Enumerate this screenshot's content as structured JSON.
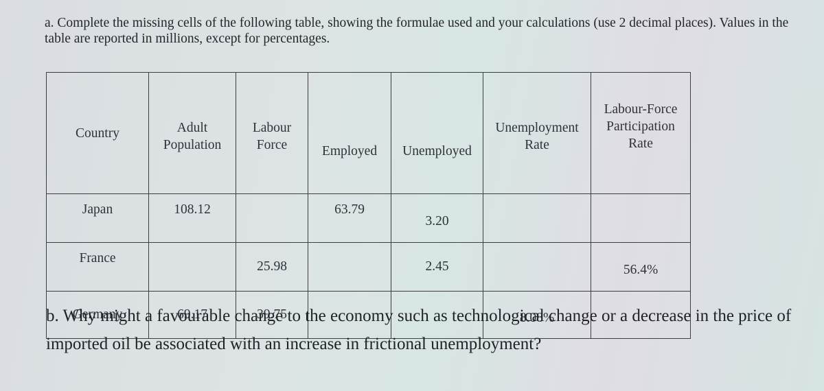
{
  "question_a": "a. Complete the missing cells of the following table, showing the formulae used and your calculations (use 2 decimal places). Values in the table are reported in millions, except for percentages.",
  "table": {
    "headers": [
      [
        "Country"
      ],
      [
        "Adult",
        "Population"
      ],
      [
        "Labour",
        "Force"
      ],
      [
        "Employed"
      ],
      [
        "Unemployed"
      ],
      [
        "Unemployment",
        "Rate"
      ],
      [
        "Labour-Force",
        "Participation",
        "Rate"
      ]
    ],
    "rows": [
      [
        "Japan",
        "108.12",
        "",
        "63.79",
        "3.20",
        "",
        ""
      ],
      [
        "France",
        "",
        "25.98",
        "",
        "2.45",
        "",
        "56.4%"
      ],
      [
        "Germany",
        "69.17",
        "39.75",
        "",
        "",
        "8.08%",
        ""
      ]
    ]
  },
  "question_b": "b. Why might a favourable change to the economy such as technological change or a decrease in the price of imported oil be associated with an increase in frictional unemployment?"
}
